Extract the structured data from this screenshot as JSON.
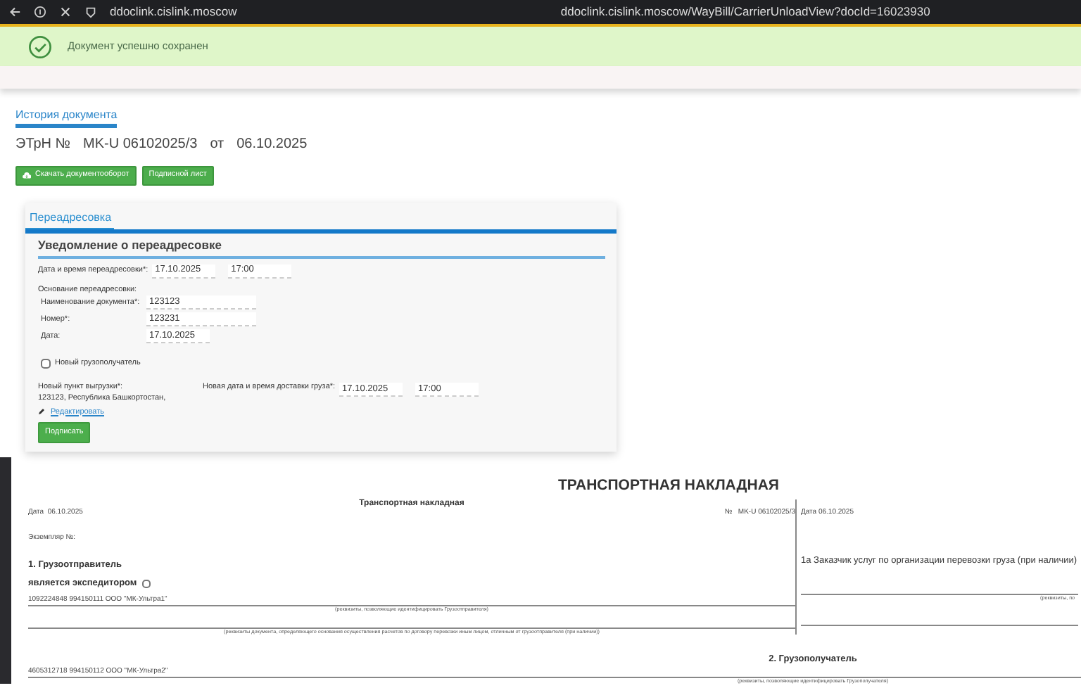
{
  "browser": {
    "host": "ddoclink.cislink.moscow",
    "url": "ddoclink.cislink.moscow/WayBill/CarrierUnloadView?docId=16023930"
  },
  "alert": {
    "text": "Документ успешно сохранен"
  },
  "history_tab": {
    "label": "История документа",
    "selected": true
  },
  "title": {
    "prefix": "ЭТрН №",
    "number": "MK-U 06102025/3",
    "sep": "от",
    "date": "06.10.2025"
  },
  "buttons": [
    {
      "label": "Скачать документооборот",
      "kind": "download"
    },
    {
      "label": "Подписной лист",
      "kind": "plain"
    }
  ],
  "redirect_panel": {
    "tab": {
      "label": "Переадресовка",
      "selected": true
    },
    "heading": "Уведомление о переадресовке",
    "datetime": {
      "label": "Дата и время переадресовки*:",
      "date": "17.10.2025",
      "time": "17:00"
    },
    "basis_label": "Основание переадресовки:",
    "basis_fields": [
      {
        "label": "Наименование документа*:",
        "value": "123123",
        "kind": "wide"
      },
      {
        "label": "Номер*:",
        "value": "123231",
        "kind": "wide"
      },
      {
        "label": "Дата:",
        "value": "17.10.2025",
        "kind": "date"
      }
    ],
    "new_consignee": {
      "label": "Новый грузополучатель",
      "checked": false
    },
    "unload_point": {
      "label": "Новый пункт выгрузки*:",
      "address": "123123, Республика Башкортостан,",
      "edit_link": "Редактировать"
    },
    "delivery": {
      "label": "Новая дата и время доставки груза*:",
      "date": "17.10.2025",
      "time": "17:00"
    },
    "sign_button": "Подписать"
  },
  "waybill": {
    "heading": "ТРАНСПОРТНАЯ НАКЛАДНАЯ",
    "left": {
      "title": "Транспортная накладная",
      "date": "Дата  06.10.2025",
      "number": "№   MK-U 06102025/3",
      "copy": "Экземпляр №:",
      "section1": "1. Грузоотправитель",
      "forwarder": {
        "label": "является экспедитором",
        "checked": false
      },
      "shipper_line": "1092224848 994150111 ООО \"МК-Ультра1\"",
      "shipper_caption": "(реквизиты, позволяющие идентифицировать Грузоотправителя)",
      "doc_caption": "(реквизиты документа, определяющего основания осуществления расчетов по договору перевозки иным лицом, отличным от грузоотправителя (при наличии))"
    },
    "right": {
      "date": "Дата 06.10.2025",
      "section1a": "1а Заказчик услуг по организации перевозки груза (при наличии)",
      "caption": "(реквизиты, по"
    },
    "section2": "2. Грузополучатель",
    "consignee_line": "4605312718 994150112 ООО \"МК-Ультра2\"",
    "consignee_caption": "(реквизиты, позволяющие идентифицировать Грузополучателя)"
  }
}
